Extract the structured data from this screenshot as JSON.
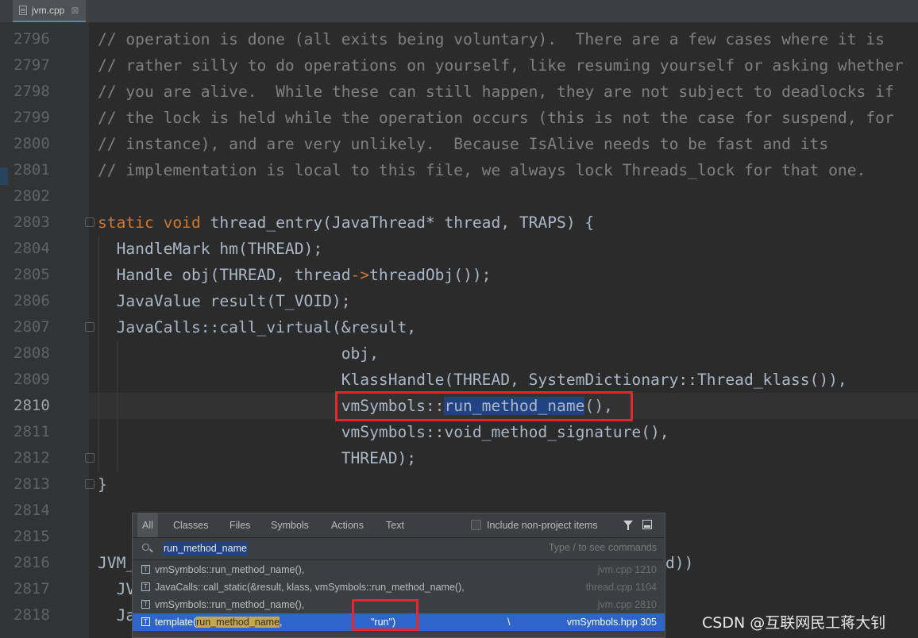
{
  "tab": {
    "label": "jvm.cpp",
    "close": "⊠"
  },
  "gutter": {
    "lines": [
      "2796",
      "2797",
      "2798",
      "2799",
      "2800",
      "2801",
      "2802",
      "2803",
      "2804",
      "2805",
      "2806",
      "2807",
      "2808",
      "2809",
      "2810",
      "2811",
      "2812",
      "2813",
      "2814",
      "2815",
      "2816",
      "2817",
      "2818"
    ]
  },
  "code": {
    "l2796": "// operation is done (all exits being voluntary).  There are a few cases where it is",
    "l2797": "// rather silly to do operations on yourself, like resuming yourself or asking whether",
    "l2798": "// you are alive.  While these can still happen, they are not subject to deadlocks if",
    "l2799": "// the lock is held while the operation occurs (this is not the case for suspend, for",
    "l2800": "// instance), and are very unlikely.  Because IsAlive needs to be fast and its",
    "l2801": "// implementation is local to this file, we always lock Threads_lock for that one.",
    "l2803_kw1": "static",
    "l2803_kw2": "void",
    "l2803_rest": " thread_entry(JavaThread* thread, TRAPS) {",
    "l2804": "  HandleMark hm(THREAD);",
    "l2805_a": "  Handle obj(THREAD, thread",
    "l2805_arrow": "->",
    "l2805_b": "threadObj());",
    "l2806": "  JavaValue result(T_VOID);",
    "l2807": "  JavaCalls::call_virtual(&result,",
    "l2808": "                          obj,",
    "l2809": "                          KlassHandle(THREAD, SystemDictionary::Thread_klass()),",
    "l2810_a": "                          vmSymbols::",
    "l2810_sel": "run_method_name",
    "l2810_b": "(),",
    "l2811": "                          vmSymbols::void_method_signature(),",
    "l2812": "                          THREAD);",
    "l2813": "}",
    "l2816": "JVM_",
    "l2816_tail": "d))",
    "l2817": "  JV",
    "l2818": "  Ja"
  },
  "popup": {
    "tabs": [
      "All",
      "Classes",
      "Files",
      "Symbols",
      "Actions",
      "Text"
    ],
    "include_label": "Include non-project items",
    "search_value": "run_method_name",
    "search_hint": "Type / to see commands",
    "results": [
      {
        "text": "vmSymbols::run_method_name(),",
        "loc": "jvm.cpp 1210"
      },
      {
        "text": "JavaCalls::call_static(&result, klass, vmSymbols::run_method_name(),",
        "loc": "thread.cpp 1104"
      },
      {
        "text": "vmSymbols::run_method_name(),",
        "loc": "jvm.cpp 2810"
      },
      {
        "text_a": "template(",
        "text_hl": "run_method_name",
        "text_b": ",",
        "text_c": "\"run\")",
        "text_d": "\\",
        "loc": "vmSymbols.hpp 305"
      }
    ]
  },
  "watermark": "CSDN @互联网民工蒋大钊"
}
